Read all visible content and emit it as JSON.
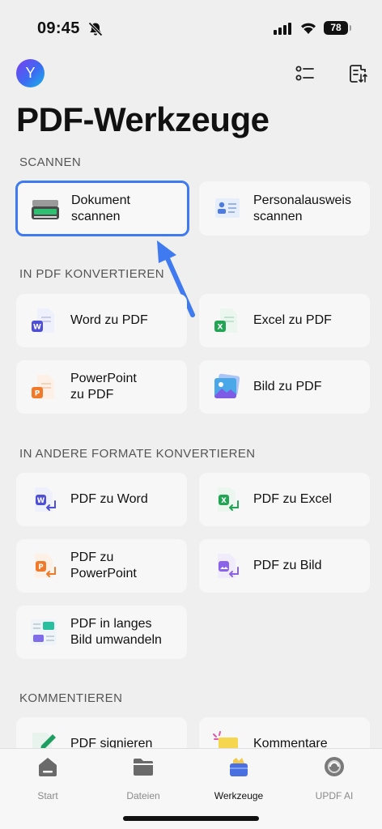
{
  "status_bar": {
    "time": "09:45",
    "battery": "78"
  },
  "header": {
    "avatar_letter": "Y",
    "title": "PDF-Werkzeuge"
  },
  "sections": {
    "scan": {
      "label": "SCANNEN",
      "items": [
        {
          "label_line1": "Dokument",
          "label_line2": "scannen"
        },
        {
          "label_line1": "Personalausweis",
          "label_line2": "scannen"
        }
      ]
    },
    "to_pdf": {
      "label": "IN PDF KONVERTIEREN",
      "items": [
        {
          "label": "Word zu PDF"
        },
        {
          "label": "Excel zu PDF"
        },
        {
          "label_line1": "PowerPoint",
          "label_line2": "zu PDF"
        },
        {
          "label": "Bild zu PDF"
        }
      ]
    },
    "from_pdf": {
      "label": "IN ANDERE FORMATE KONVERTIEREN",
      "items": [
        {
          "label": "PDF zu Word"
        },
        {
          "label": "PDF zu Excel"
        },
        {
          "label_line1": "PDF zu",
          "label_line2": "PowerPoint"
        },
        {
          "label": "PDF zu Bild"
        },
        {
          "label_line1": "PDF in langes",
          "label_line2": "Bild umwandeln"
        }
      ]
    },
    "comment": {
      "label": "KOMMENTIEREN",
      "items": [
        {
          "label": "PDF signieren"
        },
        {
          "label": "Kommentare"
        }
      ]
    }
  },
  "tabbar": {
    "tabs": [
      {
        "label": "Start"
      },
      {
        "label": "Dateien"
      },
      {
        "label": "Werkzeuge"
      },
      {
        "label": "UPDF AI"
      }
    ],
    "active": "Werkzeuge"
  },
  "colors": {
    "accent": "#3f7af0",
    "word": "#4f4fd6",
    "excel": "#23a455",
    "powerpoint": "#f07a2a"
  }
}
